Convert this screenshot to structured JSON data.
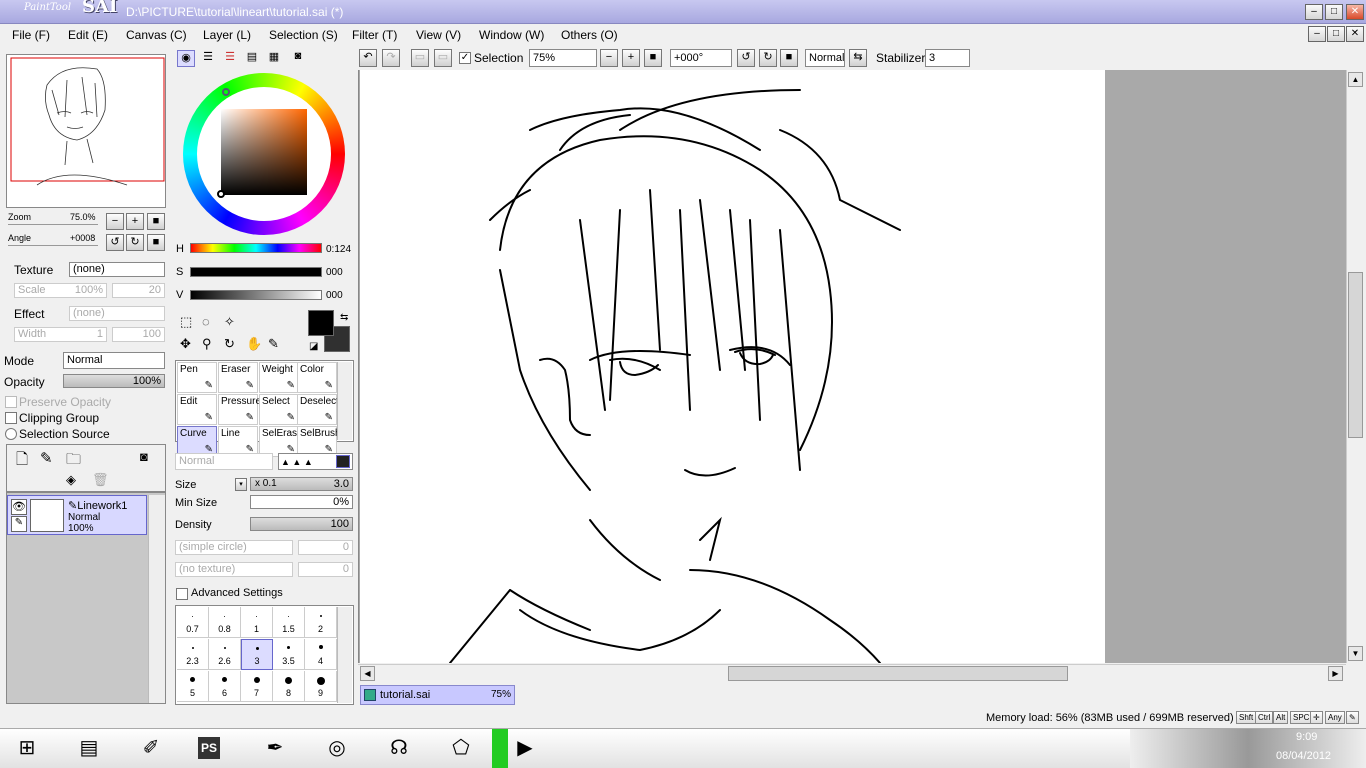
{
  "app": {
    "logo_small": "PaintTool",
    "logo_big": "SAI",
    "title": "D:\\PICTURE\\tutorial\\lineart\\tutorial.sai (*)"
  },
  "window_buttons": {
    "minimize": "‒",
    "maximize": "□",
    "close": "✕"
  },
  "menu": [
    "File (F)",
    "Edit (E)",
    "Canvas (C)",
    "Layer (L)",
    "Selection (S)",
    "Filter (T)",
    "View (V)",
    "Window (W)",
    "Others (O)"
  ],
  "navigator": {
    "zoom_label": "Zoom",
    "zoom_value": "75.0%",
    "angle_label": "Angle",
    "angle_value": "+0008"
  },
  "texture": {
    "label": "Texture",
    "value": "(none)",
    "scale_label": "Scale",
    "scale_value": "100%",
    "scale_num": "20"
  },
  "effect": {
    "label": "Effect",
    "value": "(none)",
    "width_label": "Width",
    "width_value": "1",
    "width_num": "100"
  },
  "layer_props": {
    "mode_label": "Mode",
    "mode_value": "Normal",
    "opacity_label": "Opacity",
    "opacity_value": "100%",
    "opacity": 1.0,
    "preserve_opacity": "Preserve Opacity",
    "clipping_group": "Clipping Group",
    "selection_source": "Selection Source"
  },
  "layer": {
    "name": "Linework1",
    "mode": "Normal",
    "opacity": "100%"
  },
  "color": {
    "h_label": "H",
    "h_value": "0:124",
    "s_label": "S",
    "s_value": "000",
    "v_label": "V",
    "v_value": "000",
    "primary": "#000000",
    "secondary": "#303030"
  },
  "tools": [
    {
      "label": "Pen",
      "icon": "pen-icon"
    },
    {
      "label": "Eraser",
      "icon": "eraser-icon"
    },
    {
      "label": "Weight",
      "icon": "weight-icon"
    },
    {
      "label": "Color",
      "icon": "color-icon"
    },
    {
      "label": "Edit",
      "icon": "edit-icon"
    },
    {
      "label": "Pressure",
      "icon": "pressure-icon"
    },
    {
      "label": "Select",
      "icon": "select-icon"
    },
    {
      "label": "Deselect",
      "icon": "deselect-icon"
    },
    {
      "label": "Curve",
      "icon": "curve-icon",
      "selected": true
    },
    {
      "label": "Line",
      "icon": "line-icon"
    },
    {
      "label": "SelErase",
      "icon": "selerase-icon"
    },
    {
      "label": "SelBrush",
      "icon": "selbrush-icon"
    }
  ],
  "brush": {
    "blend_mode": "Normal",
    "size_label": "Size",
    "size_mult": "x 0.1",
    "size_value": "3.0",
    "minsize_label": "Min Size",
    "minsize_value": "0%",
    "density_label": "Density",
    "density_value": "100",
    "shape": "(simple circle)",
    "shape_value": "0",
    "texture": "(no texture)",
    "texture_value": "0",
    "advanced": "Advanced Settings"
  },
  "brush_sizes": [
    "0.7",
    "0.8",
    "1",
    "1.5",
    "2",
    "2.3",
    "2.6",
    "3",
    "3.5",
    "4",
    "5",
    "6",
    "7",
    "8",
    "9"
  ],
  "brush_size_selected": "3",
  "toolbar": {
    "selection_label": "Selection",
    "zoom": "75%",
    "angle": "+000°",
    "blend": "Normal",
    "stabilizer_label": "Stabilizer",
    "stabilizer_value": "3"
  },
  "document_tab": {
    "name": "tutorial.sai",
    "zoom": "75%"
  },
  "status": {
    "memory": "Memory load: 56% (83MB used / 699MB reserved)",
    "keys": [
      "Shft",
      "Ctrl",
      "Alt",
      "SPC",
      "Any"
    ]
  },
  "taskbar": {
    "time": "9:09",
    "date": "08/04/2012",
    "apps": [
      {
        "name": "start-orb-icon",
        "glyph": "⊞"
      },
      {
        "name": "explorer-icon",
        "glyph": "▤"
      },
      {
        "name": "paintbrush-icon",
        "glyph": "✐"
      },
      {
        "name": "photoshop-icon",
        "glyph": "PS"
      },
      {
        "name": "quill-icon",
        "glyph": "✒"
      },
      {
        "name": "chrome-icon",
        "glyph": "◎"
      },
      {
        "name": "network-icon",
        "glyph": "☊"
      },
      {
        "name": "shape-icon",
        "glyph": "⬠"
      },
      {
        "name": "media-player-icon",
        "glyph": "▶"
      }
    ]
  }
}
